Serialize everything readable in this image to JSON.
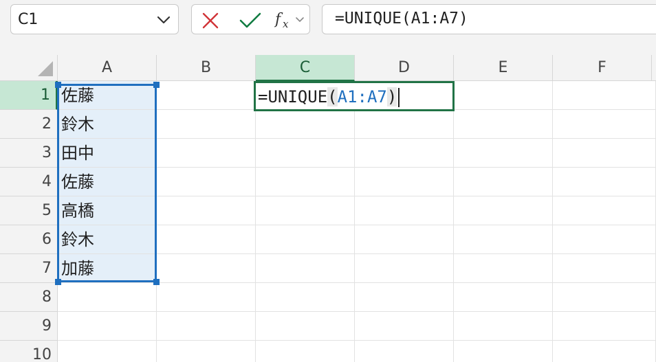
{
  "name_box": {
    "value": "C1"
  },
  "formula_bar": {
    "formula": "=UNIQUE(A1:A7)"
  },
  "columns": [
    "A",
    "B",
    "C",
    "D",
    "E",
    "F"
  ],
  "rows": [
    "1",
    "2",
    "3",
    "4",
    "5",
    "6",
    "7",
    "8",
    "9",
    "10"
  ],
  "cells": {
    "A1": "佐藤",
    "A2": "鈴木",
    "A3": "田中",
    "A4": "佐藤",
    "A5": "高橋",
    "A6": "鈴木",
    "A7": "加藤"
  },
  "editing_cell": {
    "address": "C1",
    "prefix": "=UNIQUE",
    "open_paren": "(",
    "range_ref": "A1:A7",
    "close_paren": ")"
  },
  "colors": {
    "accent_green": "#217346",
    "range_blue": "#1f6fbf",
    "cancel_red": "#d13438",
    "enter_green": "#107c41"
  },
  "icons": {
    "cancel": "cancel-icon",
    "enter": "enter-icon",
    "function": "fx-icon",
    "namebox_dropdown": "chevron-down-icon",
    "select_all": "select-all-triangle-icon"
  }
}
